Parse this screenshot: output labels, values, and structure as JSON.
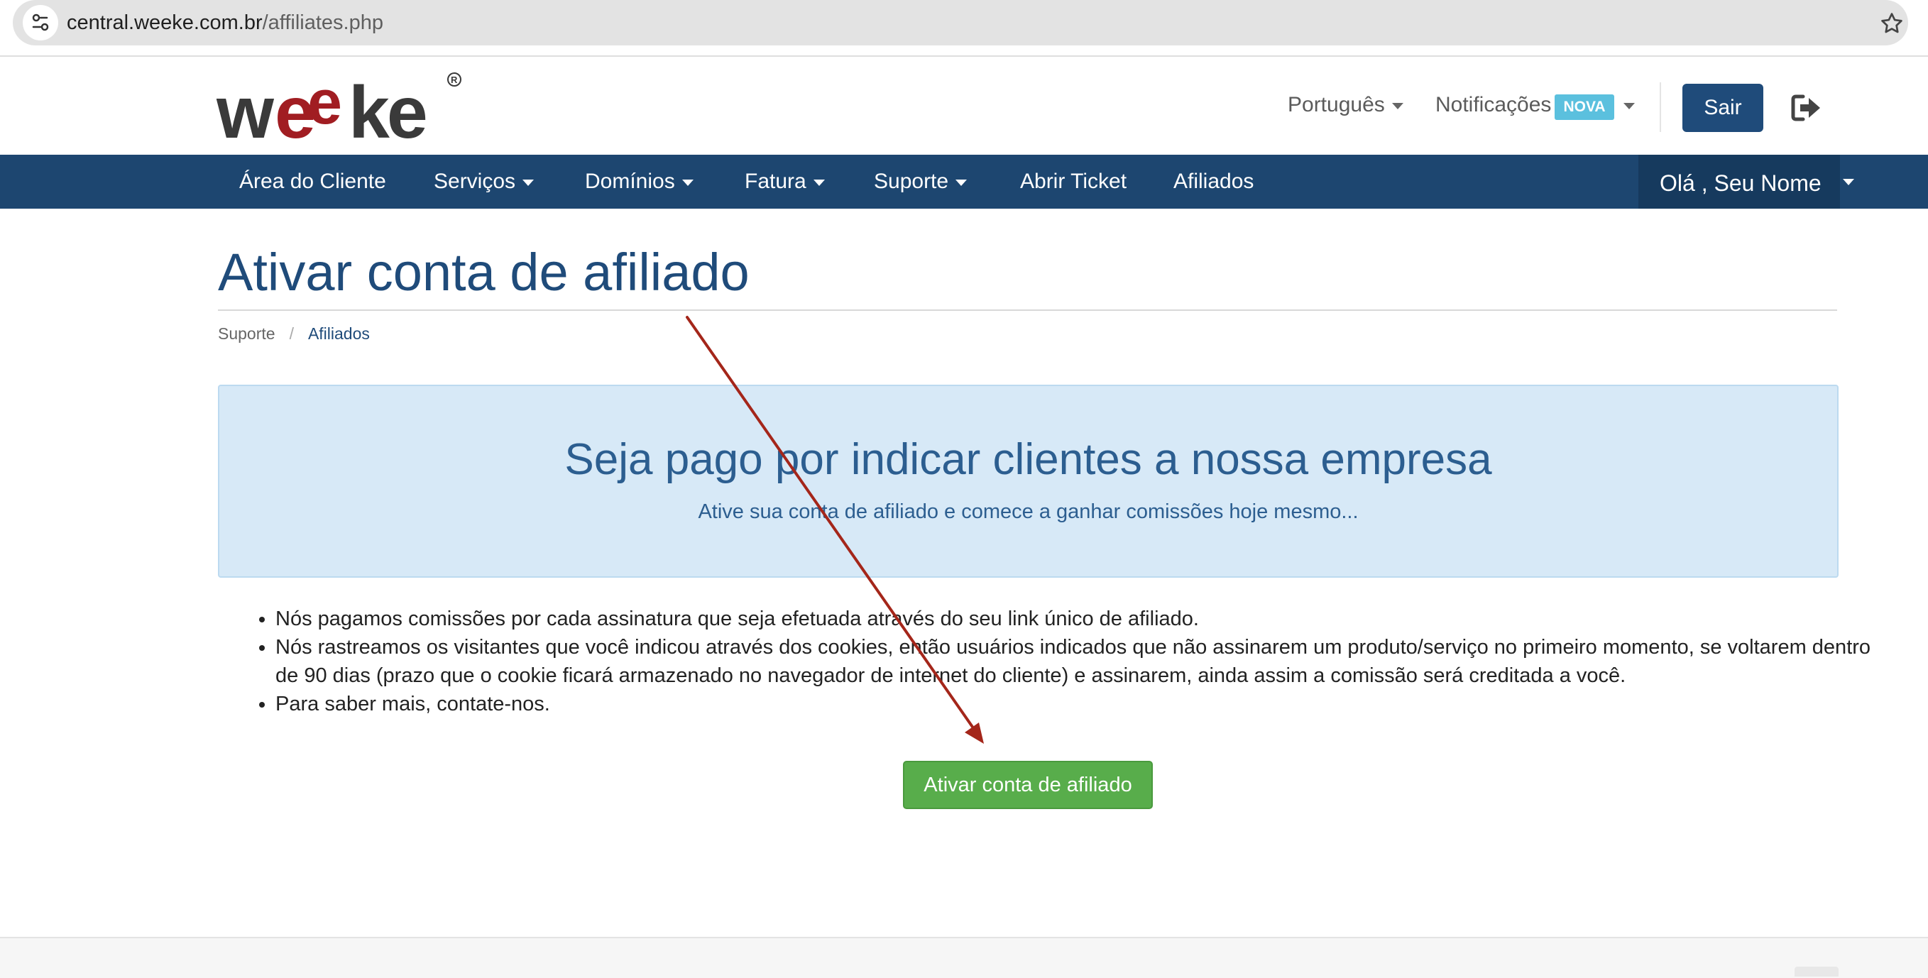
{
  "browser": {
    "url_host": "central.weeke.com.br",
    "url_path": "/affiliates.php"
  },
  "header": {
    "logo_text": "weeke",
    "language": "Português",
    "notifications": "Notificações",
    "notifications_badge": "NOVA",
    "logout_label": "Sair"
  },
  "nav": {
    "items": [
      {
        "label": "Área do Cliente",
        "dropdown": false
      },
      {
        "label": "Serviços",
        "dropdown": true
      },
      {
        "label": "Domínios",
        "dropdown": true
      },
      {
        "label": "Fatura",
        "dropdown": true
      },
      {
        "label": "Suporte",
        "dropdown": true
      },
      {
        "label": "Abrir Ticket",
        "dropdown": false
      },
      {
        "label": "Afiliados",
        "dropdown": false
      }
    ],
    "user_greeting": "Olá , Seu Nome"
  },
  "page": {
    "title": "Ativar conta de afiliado",
    "breadcrumb": [
      "Suporte",
      "Afiliados"
    ],
    "promo_title": "Seja pago por indicar clientes a nossa empresa",
    "promo_subtitle": "Ative sua conta de afiliado e comece a ganhar comissões hoje mesmo...",
    "benefits": [
      "Nós pagamos comissões por cada assinatura que seja efetuada através do seu link único de afiliado.",
      "Nós rastreamos os visitantes que você indicou através dos cookies, então usuários indicados que não assinarem um produto/serviço no primeiro momento, se voltarem dentro de 90 dias (prazo que o cookie ficará armazenado no navegador de internet do cliente) e assinarem, ainda assim a comissão será creditada a você.",
      "Para saber mais, contate-nos."
    ],
    "activate_button": "Ativar conta de afiliado"
  },
  "colors": {
    "brand_dark": "#1d4670",
    "brand_text": "#1f4b7a",
    "promo_bg": "#d7e9f7",
    "success": "#58ad4b",
    "badge": "#5bc0de",
    "logo_red": "#a11d22",
    "annotation_arrow": "#a4261a"
  }
}
